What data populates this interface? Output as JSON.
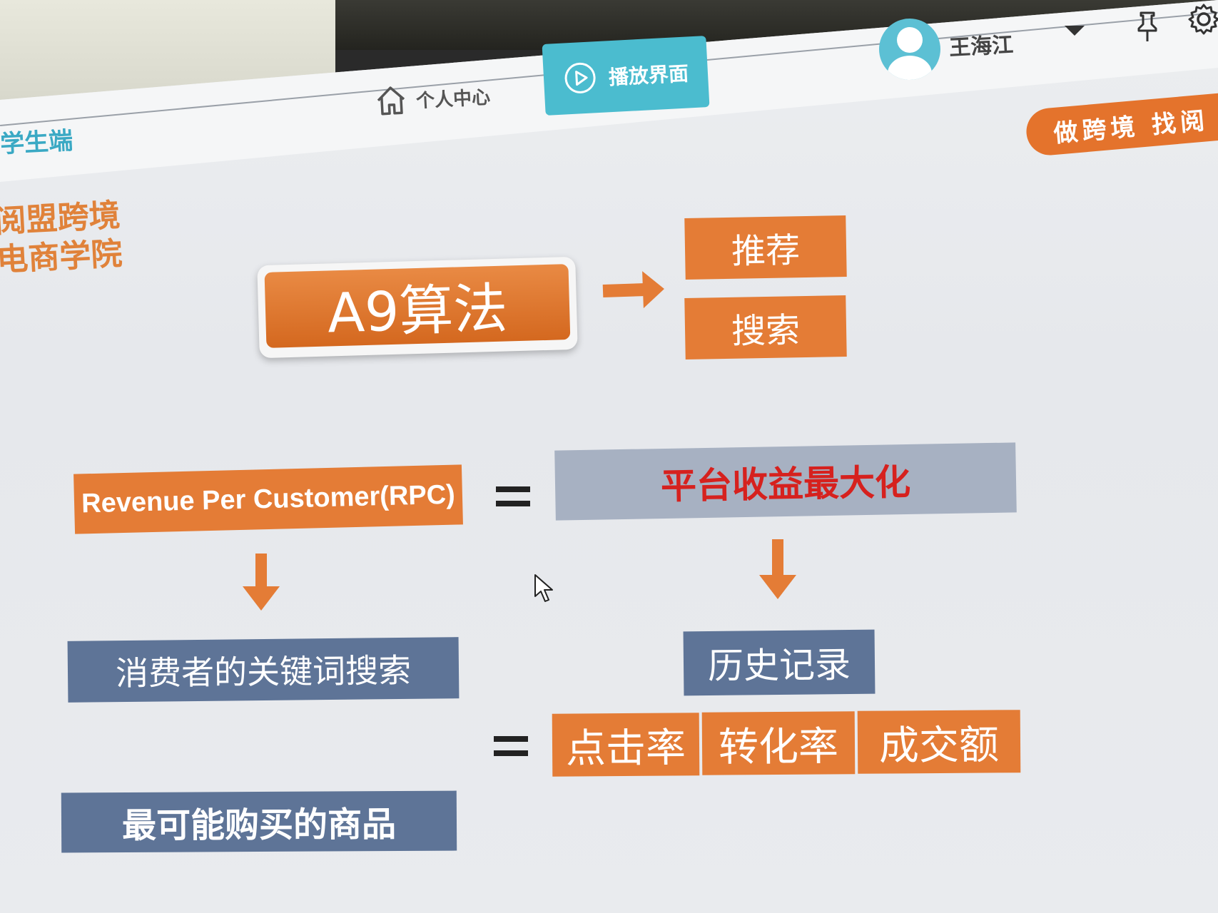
{
  "header": {
    "brand": "学生端",
    "nav_home": "个人中心",
    "nav_play": "播放界面",
    "username": "王海江",
    "slogan": "做跨境 找阅"
  },
  "icons": [
    "home-icon",
    "play-circle-icon",
    "avatar",
    "chevron-down-icon",
    "pin-icon",
    "gear-icon",
    "mouse-cursor-icon"
  ],
  "slide": {
    "school_logo": [
      "阅盟跨境",
      "电商学院"
    ],
    "algorithm": "A9算法",
    "outputs": [
      "推荐",
      "搜索"
    ],
    "rpc_label": "Revenue Per Customer(RPC)",
    "equals": "=",
    "goal": "平台收益最大化",
    "left_step": "消费者的关键词搜索",
    "right_step": "历史记录",
    "metrics": [
      "点击率",
      "转化率",
      "成交额"
    ],
    "result": "最可能购买的商品"
  },
  "colors": {
    "orange": "#e47c36",
    "slate": "#5e7497",
    "light_slate": "#a7b1c2",
    "red_text": "#d6211e",
    "teal": "#4bbccf"
  }
}
